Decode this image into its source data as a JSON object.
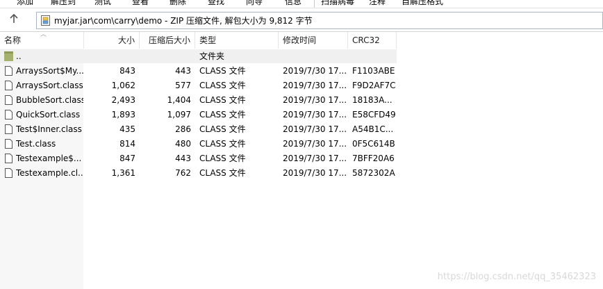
{
  "toolbar": {
    "items": [
      "添加",
      "解压到",
      "测试",
      "查看",
      "删除",
      "查找",
      "向导",
      "信息",
      "扫描病毒",
      "注释",
      "自解压格式"
    ]
  },
  "pathbar": {
    "up_icon": "up-arrow-icon",
    "path": "myjar.jar\\com\\carry\\demo - ZIP 压缩文件, 解包大小为 9,812 字节"
  },
  "columns": {
    "name": "名称",
    "size": "大小",
    "packed": "压缩后大小",
    "type": "类型",
    "modified": "修改时间",
    "crc": "CRC32"
  },
  "rows": [
    {
      "name": "..",
      "size": "",
      "packed": "",
      "type": "文件夹",
      "modified": "",
      "crc": ""
    },
    {
      "name": "ArraysSort$My...",
      "size": "843",
      "packed": "443",
      "type": "CLASS 文件",
      "modified": "2019/7/30 17...",
      "crc": "F1103ABE"
    },
    {
      "name": "ArraysSort.class",
      "size": "1,062",
      "packed": "577",
      "type": "CLASS 文件",
      "modified": "2019/7/30 17...",
      "crc": "F9D2AF7C"
    },
    {
      "name": "BubbleSort.class",
      "size": "2,493",
      "packed": "1,404",
      "type": "CLASS 文件",
      "modified": "2019/7/30 17...",
      "crc": "18183A..."
    },
    {
      "name": "QuickSort.class",
      "size": "1,893",
      "packed": "1,097",
      "type": "CLASS 文件",
      "modified": "2019/7/30 17...",
      "crc": "E58CFD49"
    },
    {
      "name": "Test$Inner.class",
      "size": "435",
      "packed": "286",
      "type": "CLASS 文件",
      "modified": "2019/7/30 17...",
      "crc": "A54B1C..."
    },
    {
      "name": "Test.class",
      "size": "814",
      "packed": "480",
      "type": "CLASS 文件",
      "modified": "2019/7/30 17...",
      "crc": "0F5C614B"
    },
    {
      "name": "Testexample$...",
      "size": "847",
      "packed": "443",
      "type": "CLASS 文件",
      "modified": "2019/7/30 17...",
      "crc": "7BFF20A6"
    },
    {
      "name": "Testexample.cl...",
      "size": "1,361",
      "packed": "762",
      "type": "CLASS 文件",
      "modified": "2019/7/30 17...",
      "crc": "5872302A"
    }
  ],
  "watermark": "https://blog.csdn.net/qq_35462323"
}
